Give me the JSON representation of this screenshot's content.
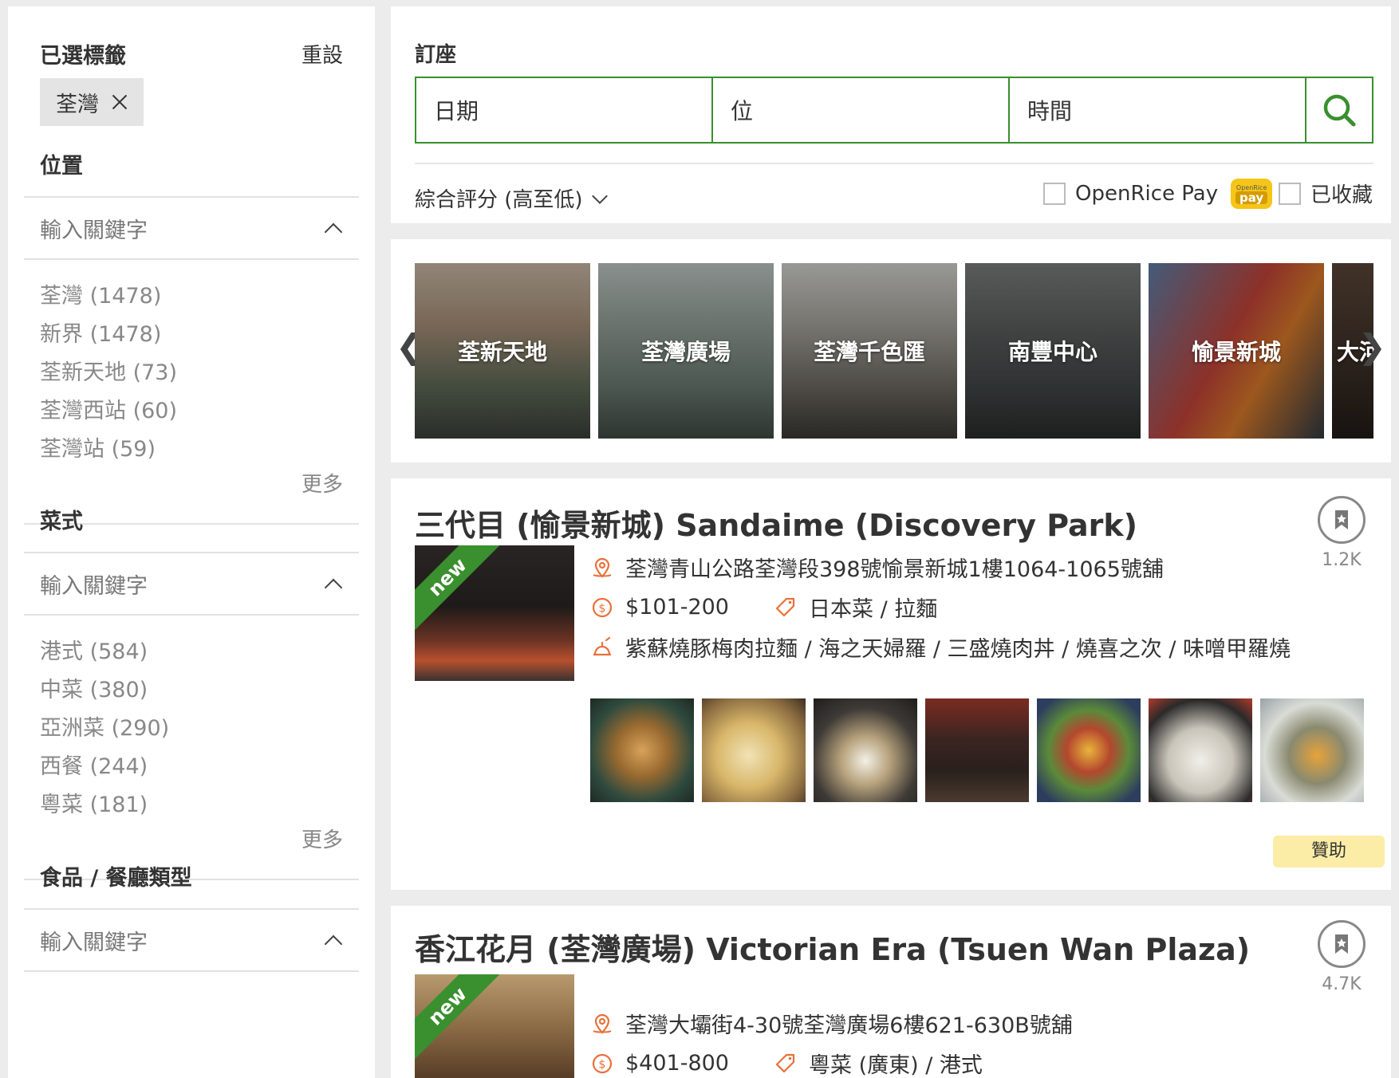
{
  "sidebar": {
    "selected_title": "已選標籤",
    "reset_label": "重設",
    "selected_tag": "荃灣",
    "location": {
      "title": "位置",
      "keyword_placeholder": "輸入關鍵字",
      "options": [
        "荃灣 (1478)",
        "新界 (1478)",
        "荃新天地 (73)",
        "荃灣西站 (60)",
        "荃灣站 (59)"
      ],
      "more_label": "更多"
    },
    "cuisine": {
      "title": "菜式",
      "keyword_placeholder": "輸入關鍵字",
      "options": [
        "港式 (584)",
        "中菜 (380)",
        "亞洲菜 (290)",
        "西餐 (244)",
        "粵菜 (181)"
      ],
      "more_label": "更多"
    },
    "dish_type": {
      "title": "食品 / 餐廳類型",
      "keyword_placeholder": "輸入關鍵字"
    }
  },
  "booking": {
    "title": "訂座",
    "date_label": "日期",
    "seats_label": "位",
    "time_label": "時間",
    "sort_label": "綜合評分 (高至低)",
    "openrice_pay_label": "OpenRice Pay",
    "pay_badge_top": "OpenRice",
    "pay_badge_text": "pay",
    "bookmarked_label": "已收藏"
  },
  "malls": [
    "荃新天地",
    "荃灣廣場",
    "荃灣千色匯",
    "南豐中心",
    "愉景新城",
    "大河"
  ],
  "restaurants": [
    {
      "name": "三代目 (愉景新城) Sandaime (Discovery Park)",
      "bookmark_count": "1.2K",
      "badge": "new",
      "address": "荃灣青山公路荃灣段398號愉景新城1樓1064-1065號舖",
      "price": "$101-200",
      "cuisine": "日本菜 / 拉麵",
      "dishes": "紫蘇燒豚梅肉拉麵 / 海之天婦羅 / 三盛燒肉丼 / 燒喜之次 / 味噌甲羅燒",
      "sponsor_label": "贊助"
    },
    {
      "name": "香江花月 (荃灣廣場) Victorian Era (Tsuen Wan Plaza)",
      "bookmark_count": "4.7K",
      "badge": "new",
      "address": "荃灣大壩街4-30號荃灣廣場6樓621-630B號舖",
      "price": "$401-800",
      "cuisine": "粵菜 (廣東) / 港式"
    }
  ],
  "colors": {
    "brand_green": "#3a8f2e",
    "icon_orange": "#e8703a",
    "sponsor_bg": "#fbeda6",
    "pay_yellow": "#f5c518"
  }
}
